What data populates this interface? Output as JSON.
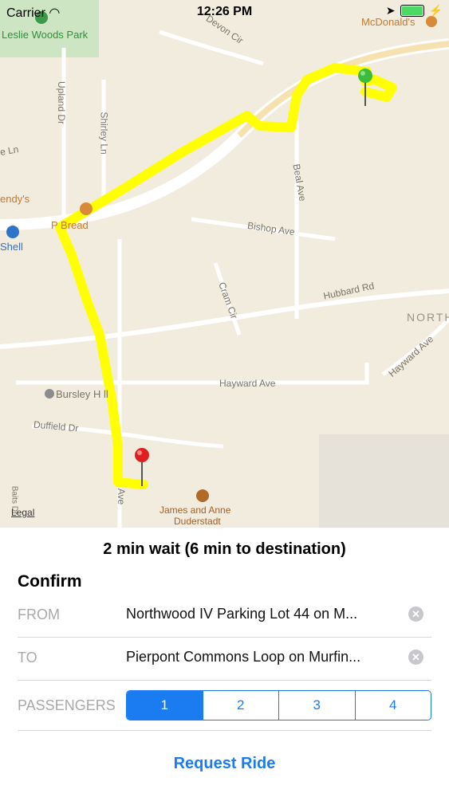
{
  "status_bar": {
    "carrier": "Carrier",
    "time": "12:26 PM"
  },
  "map": {
    "labels": {
      "park": "Leslie Woods Park",
      "mcdonalds": "McDonald's",
      "devon": "Devon Cir",
      "upland": "Upland Dr",
      "shirley": "Shirley Ln",
      "beal": "Beal Ave",
      "le_ln": "e Ln",
      "endys": "endy's",
      "panera": "P    Bread",
      "shell": "Shell",
      "bishop": "Bishop Ave",
      "hubbard": "Hubbard Rd",
      "north": "NORTH",
      "hayward_ave_diag": "Hayward Ave",
      "cram": "Cram Cir",
      "hayward": "Hayward Ave",
      "bursley": "Bursley H  ll",
      "duffield": "Duffield Dr",
      "ave": "Ave",
      "baits": "Baits Dr",
      "james1": "James and Anne",
      "james2": "Duderstadt"
    },
    "legal": "Legal",
    "route_color": "#ffff00",
    "start_pin_color": "#3dbb3d",
    "end_pin_color": "#e02020"
  },
  "ride": {
    "wait_text": "2 min wait (6 min to destination)",
    "confirm_title": "Confirm",
    "from_label": "FROM",
    "from_value": "Northwood IV Parking Lot 44 on M...",
    "to_label": "TO",
    "to_value": "Pierpont Commons Loop on Murfin...",
    "passengers_label": "PASSENGERS",
    "passenger_options": [
      "1",
      "2",
      "3",
      "4"
    ],
    "selected_passengers": "1",
    "request_label": "Request Ride"
  }
}
